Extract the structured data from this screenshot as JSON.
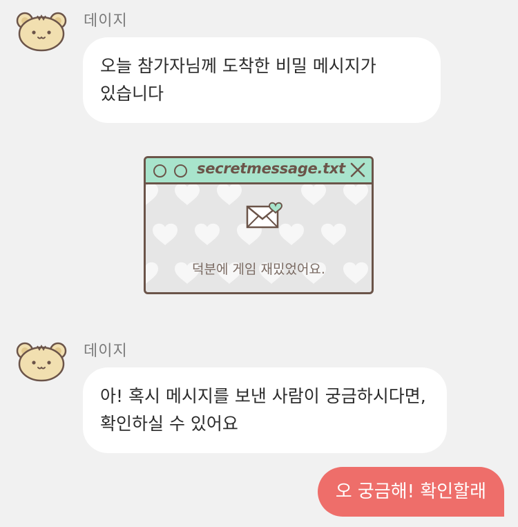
{
  "messages": [
    {
      "sender": "데이지",
      "text": "오늘 참가자님께 도착한 비밀 메시지가 있습니다"
    },
    {
      "card": {
        "title": "secretmessage.txt",
        "body": "덕분에 게임 재밌었어요."
      }
    },
    {
      "sender": "데이지",
      "text": "아! 혹시 메시지를 보낸 사람이 궁금하시다면, 확인하실 수 있어요"
    },
    {
      "reply": "오 궁금해! 확인할래"
    }
  ],
  "colors": {
    "background": "#f1f1f1",
    "incoming_bubble": "#ffffff",
    "outgoing_bubble": "#ee6e6a",
    "card_header": "#a8e4cc",
    "card_border": "#6b5449"
  },
  "icons": [
    "bear-avatar-icon",
    "close-icon",
    "envelope-heart-icon",
    "heart-pattern"
  ]
}
